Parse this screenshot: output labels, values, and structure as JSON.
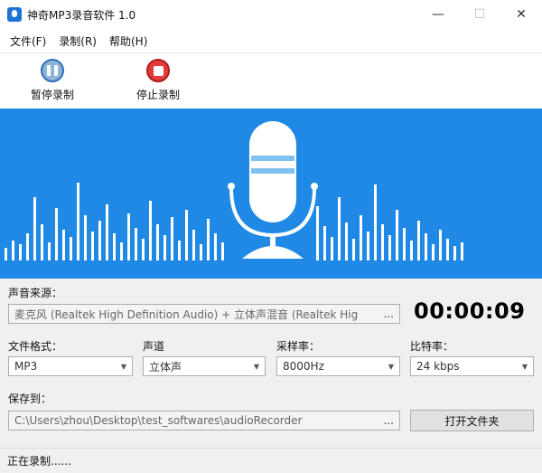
{
  "window": {
    "title": "神奇MP3录音软件 1.0"
  },
  "menu": [
    {
      "label": "文件(F)"
    },
    {
      "label": "录制(R)"
    },
    {
      "label": "帮助(H)"
    }
  ],
  "toolbar": {
    "pause_label": "暂停录制",
    "stop_label": "停止录制"
  },
  "colors": {
    "visualizer_bg": "#1f89e5",
    "stop_red": "#e23b3b",
    "pause_blue": "#2f6fb5"
  },
  "source": {
    "label": "声音来源：",
    "value": "麦克风 (Realtek High Definition Audio) + 立体声混音 (Realtek Hig",
    "browse": "..."
  },
  "timer": "00:00:09",
  "format": {
    "label": "文件格式：",
    "value": "MP3"
  },
  "channel": {
    "label": "声道",
    "value": "立体声"
  },
  "samplerate": {
    "label": "采样率：",
    "value": "8000Hz"
  },
  "bitrate": {
    "label": "比特率：",
    "value": "24 kbps"
  },
  "save": {
    "label": "保存到：",
    "path": "C:\\Users\\zhou\\Desktop\\test_softwares\\audioRecorder",
    "browse": "...",
    "open_folder": "打开文件夹"
  },
  "status": "正在录制......"
}
